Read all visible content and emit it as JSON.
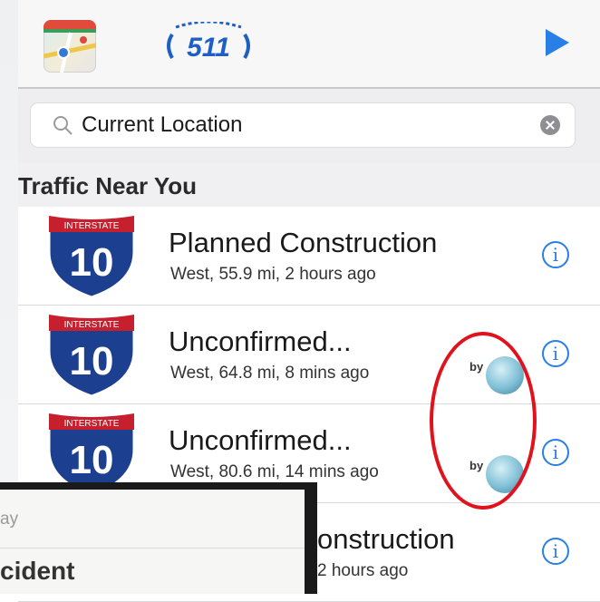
{
  "app": {
    "logo_text": "511",
    "icons": {
      "maps": "maps-app-icon",
      "play": "play-icon"
    }
  },
  "search": {
    "value": "Current Location",
    "icon": "search-icon",
    "clear_icon": "clear-icon"
  },
  "section": {
    "title": "Traffic Near You"
  },
  "shield": {
    "top_text": "INTERSTATE",
    "number": "10"
  },
  "rows": [
    {
      "title": "Planned Construction",
      "subtitle": "West, 55.9 mi, 2 hours ago",
      "waze": false
    },
    {
      "title": "Unconfirmed...",
      "subtitle": "West, 64.8 mi, 8 mins ago",
      "waze": true,
      "waze_label": "by"
    },
    {
      "title": "Unconfirmed...",
      "subtitle": "West, 80.6 mi, 14 mins ago",
      "waze": true,
      "waze_label": "by"
    },
    {
      "title": "onstruction",
      "subtitle": "2 hours ago",
      "waze": false
    }
  ],
  "overlay": {
    "fragment_top": "ay",
    "fragment_bottom": "cident"
  },
  "colors": {
    "accent": "#2a7fe6",
    "highlight": "#e0121b",
    "shield_blue": "#1d3f8f",
    "shield_red": "#c6202f"
  }
}
